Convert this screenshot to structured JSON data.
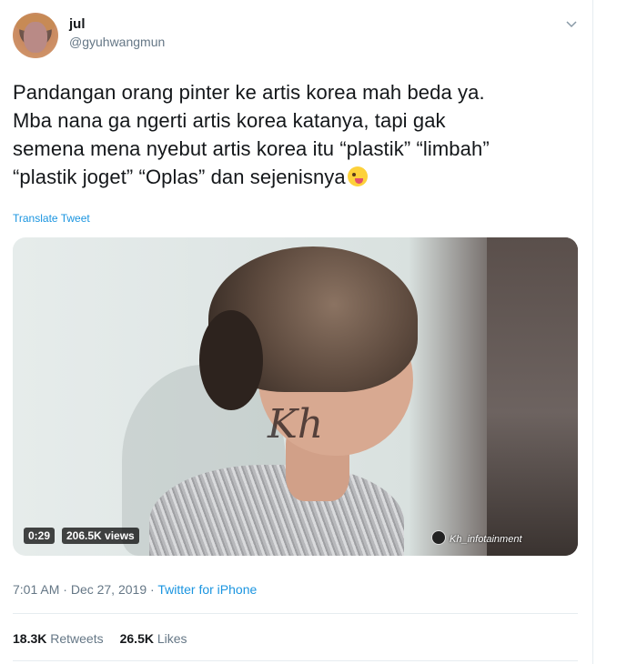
{
  "user": {
    "name": "jul",
    "handle": "@gyuhwangmun"
  },
  "tweet": {
    "text_lines": [
      "Pandangan orang pinter ke artis korea mah beda ya.",
      "Mba nana ga ngerti artis korea katanya, tapi gak",
      "semena mena nyebut artis korea itu “plastik” “limbah”",
      "“plastik joget” “Oplas” dan sejenisnya"
    ],
    "translate_label": "Translate Tweet"
  },
  "media": {
    "duration": "0:29",
    "views": "206.5K views",
    "watermark": "Kh",
    "channel": "Kh_infotainment"
  },
  "meta": {
    "time": "7:01 AM",
    "separator": "·",
    "date": "Dec 27, 2019",
    "source": "Twitter for iPhone"
  },
  "stats": {
    "retweets_count": "18.3K",
    "retweets_label": "Retweets",
    "likes_count": "26.5K",
    "likes_label": "Likes"
  },
  "icons": {
    "caret": "chevron-down-icon",
    "emoji": "zany-face-emoji"
  },
  "colors": {
    "link": "#1b95e0",
    "secondary_text": "#657786",
    "primary_text": "#14171a"
  }
}
